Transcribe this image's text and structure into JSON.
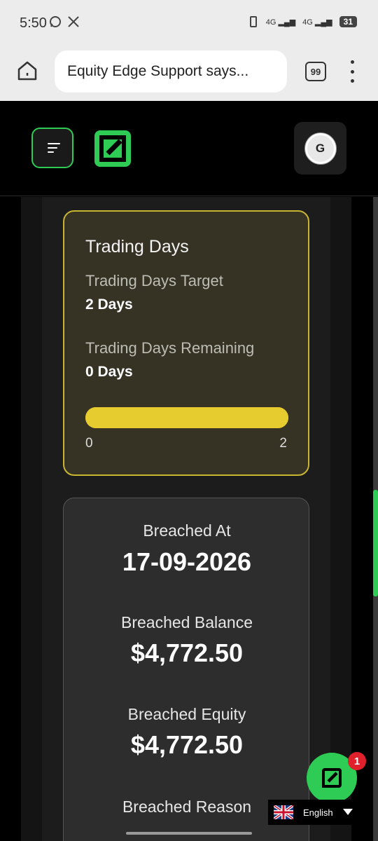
{
  "status_bar": {
    "time": "5:50",
    "network_1": "4G",
    "network_2": "4G",
    "battery": "31"
  },
  "browser": {
    "url_text": "Equity Edge Support says...",
    "tab_count": "99"
  },
  "header": {
    "avatar_initial": "G",
    "brand_color": "#2ecc55"
  },
  "trading_days": {
    "title": "Trading Days",
    "target_label": "Trading Days Target",
    "target_value": "2 Days",
    "remaining_label": "Trading Days Remaining",
    "remaining_value": "0 Days",
    "progress_min": "0",
    "progress_max": "2",
    "progress_fraction": 1.0
  },
  "breach": {
    "at_label": "Breached At",
    "at_value": "17-09-2026",
    "balance_label": "Breached Balance",
    "balance_value": "$4,772.50",
    "equity_label": "Breached Equity",
    "equity_value": "$4,772.50",
    "reason_label": "Breached Reason"
  },
  "chat": {
    "badge_count": "1"
  },
  "language": {
    "label": "English"
  }
}
